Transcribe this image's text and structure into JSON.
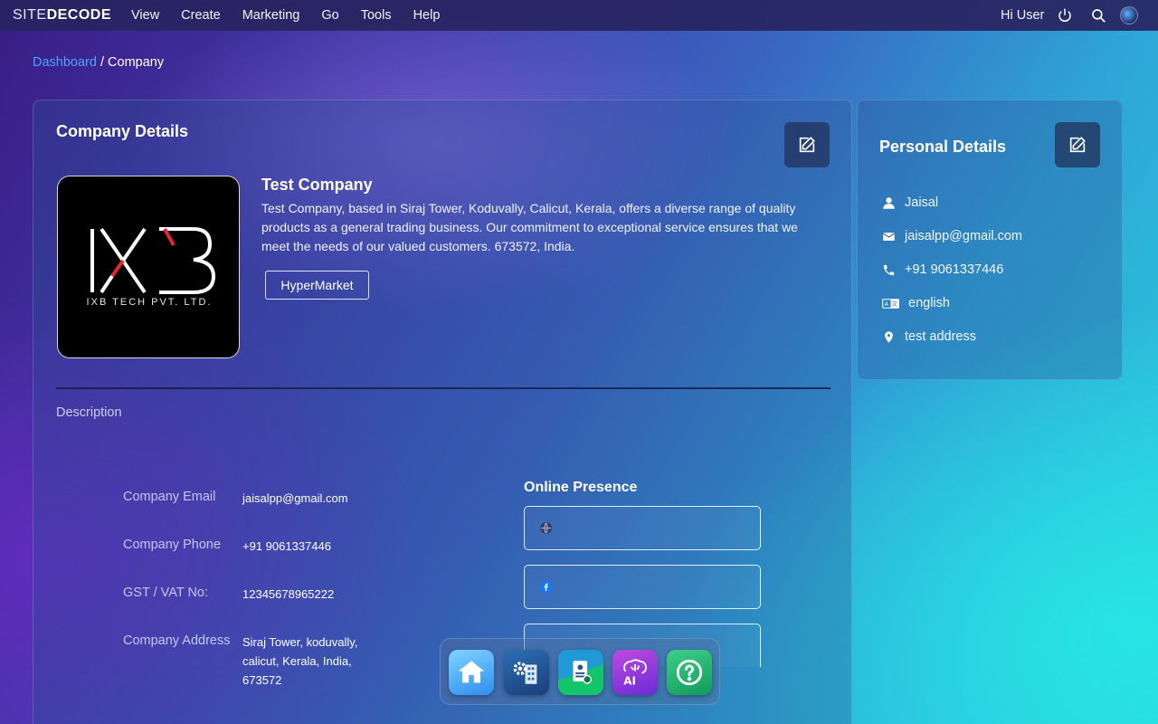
{
  "topbar": {
    "brand_light": "SITE",
    "brand_bold": "DECODE",
    "menu": [
      "View",
      "Create",
      "Marketing",
      "Go",
      "Tools",
      "Help"
    ],
    "greeting": "Hi User"
  },
  "breadcrumb": {
    "link": "Dashboard",
    "separator": " / ",
    "current": "Company"
  },
  "company": {
    "section_title": "Company Details",
    "logo_text": "IXB TECH PVT. LTD.",
    "name": "Test Company",
    "description": "Test Company, based in Siraj Tower, Koduvally, Calicut, Kerala, offers a diverse range of quality products as a general trading business. Our commitment to exceptional service ensures that we meet the needs of our valued customers. 673572, India.",
    "category": "HyperMarket",
    "description_label": "Description",
    "info": [
      {
        "label": "Company Email",
        "value": "jaisalpp@gmail.com"
      },
      {
        "label": "Company Phone",
        "value": "+91 9061337446"
      },
      {
        "label": "GST / VAT No:",
        "value": "12345678965222"
      },
      {
        "label": "Company Address",
        "value": "Siraj Tower, koduvally, calicut, Kerala, India, 673572"
      }
    ],
    "online_presence_title": "Online Presence"
  },
  "personal": {
    "title": "Personal Details",
    "name": "Jaisal",
    "email": "jaisalpp@gmail.com",
    "phone": "+91 9061337446",
    "language": "english",
    "address": "test address"
  },
  "dock": {
    "apps": [
      "home-app",
      "company-settings-app",
      "billing-app",
      "ai-app",
      "help-app"
    ]
  },
  "colors": {
    "link": "#4aa3ff",
    "topbar": "#282460",
    "facebook": "#1877f2"
  }
}
